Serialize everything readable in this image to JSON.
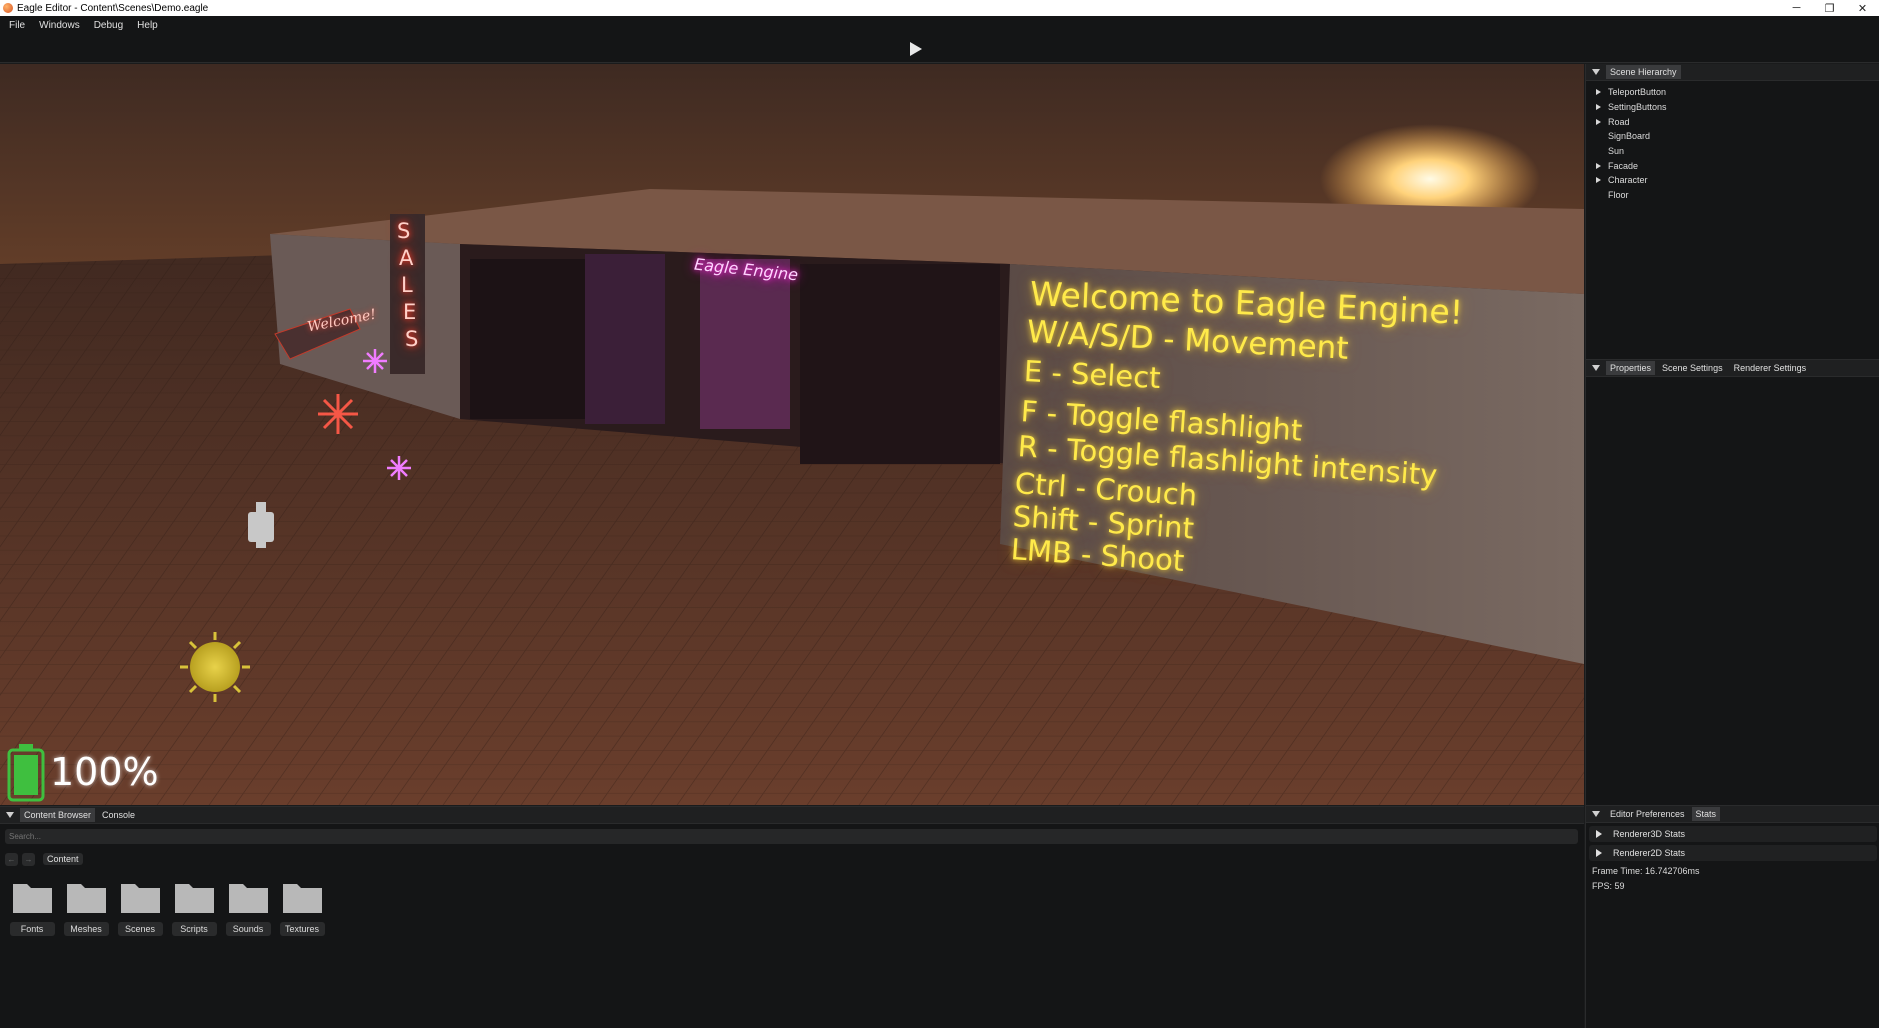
{
  "window": {
    "title": "Eagle Editor - Content\\Scenes\\Demo.eagle",
    "min_glyph": "─",
    "restore_glyph": "❐",
    "close_glyph": "✕"
  },
  "menu": [
    "File",
    "Windows",
    "Debug",
    "Help"
  ],
  "toolbar": {
    "play_icon": "play-icon"
  },
  "viewport": {
    "sign_lines": [
      "Welcome to Eagle Engine!",
      "W/A/S/D - Movement",
      "E - Select",
      "F - Toggle flashlight",
      "R - Toggle flashlight intensity",
      "Ctrl - Crouch",
      "Shift - Sprint",
      "LMB - Shoot"
    ],
    "neon_eagle": "Eagle Engine",
    "neon_welcome": "Welcome!",
    "neon_sales": [
      "S",
      "A",
      "L",
      "E",
      "S"
    ],
    "battery_percent": "100%",
    "battery_level": 1.0
  },
  "hierarchy": {
    "tab": "Scene Hierarchy",
    "items": [
      {
        "label": "TeleportButton",
        "expandable": true
      },
      {
        "label": "SettingButtons",
        "expandable": true
      },
      {
        "label": "Road",
        "expandable": true
      },
      {
        "label": "SignBoard",
        "expandable": false
      },
      {
        "label": "Sun",
        "expandable": false
      },
      {
        "label": "Facade",
        "expandable": true
      },
      {
        "label": "Character",
        "expandable": true
      },
      {
        "label": "Floor",
        "expandable": false
      }
    ]
  },
  "properties": {
    "tabs": [
      "Properties",
      "Scene Settings",
      "Renderer Settings"
    ]
  },
  "stats": {
    "tabs": [
      "Editor Preferences",
      "Stats"
    ],
    "rows": [
      "Renderer3D Stats",
      "Renderer2D Stats"
    ],
    "frame_time": "Frame Time: 16.742706ms",
    "fps": "FPS: 59"
  },
  "content_browser": {
    "tabs": [
      "Content Browser",
      "Console"
    ],
    "search_placeholder": "Search...",
    "back_glyph": "←",
    "forward_glyph": "→",
    "breadcrumb": "Content",
    "folders": [
      "Fonts",
      "Meshes",
      "Scenes",
      "Scripts",
      "Sounds",
      "Textures"
    ]
  },
  "colors": {
    "panel_bg": "#141516",
    "sign_text": "#ffea4a",
    "neon_pink": "#ff33dd",
    "neon_red": "#ff3b2a",
    "battery": "#3fbf3f"
  }
}
